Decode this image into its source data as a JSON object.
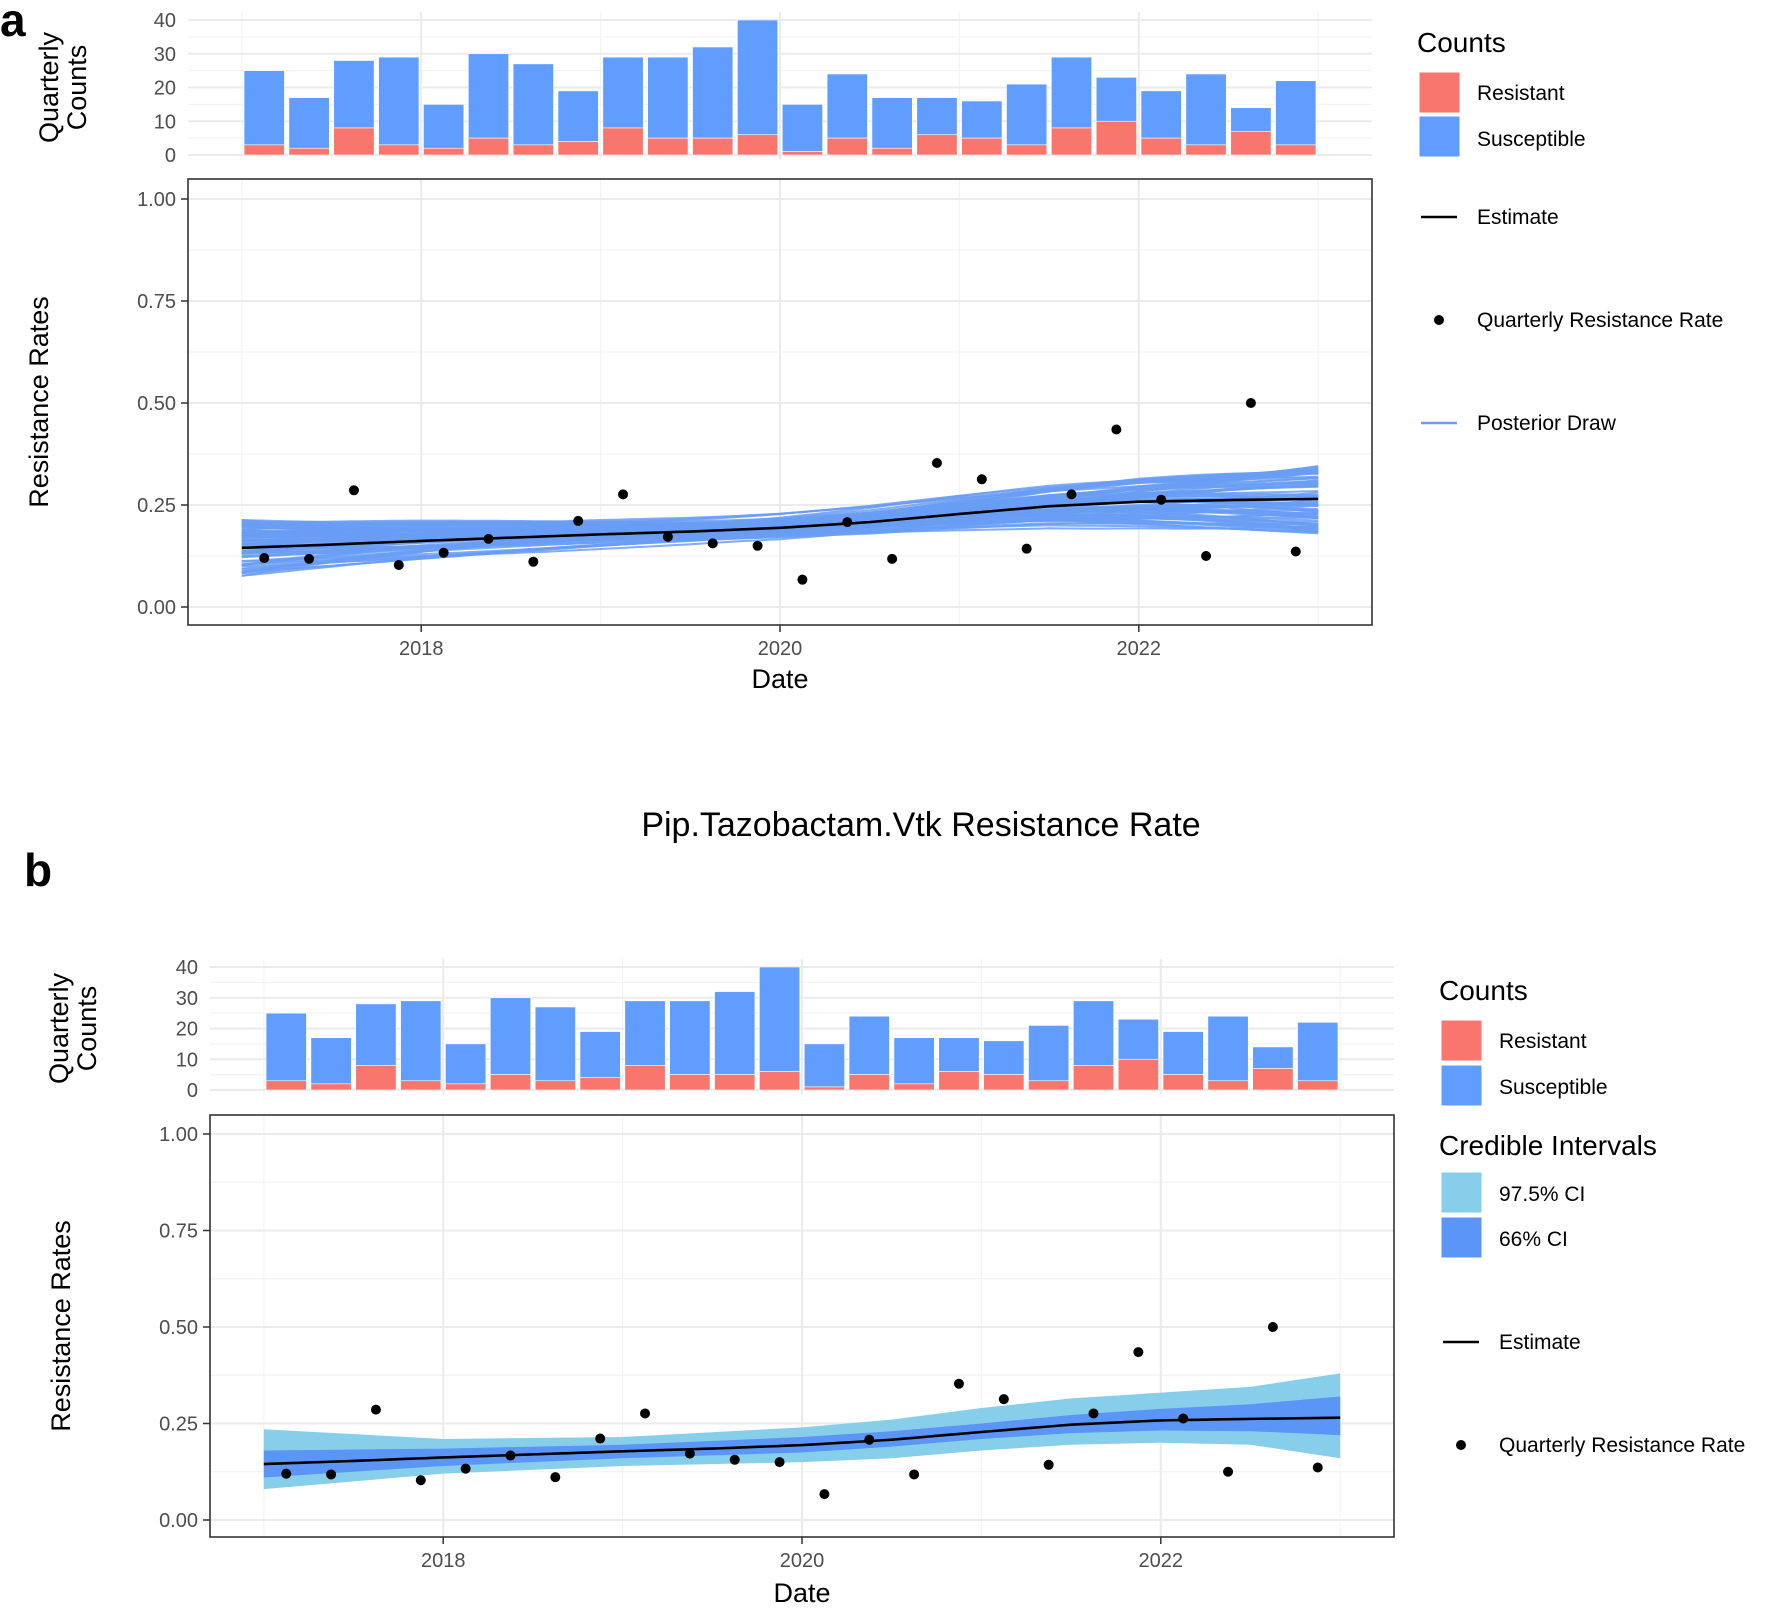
{
  "panel_labels": [
    "a",
    "b"
  ],
  "title_b": "Pip.Tazobactam.Vtk Resistance Rate",
  "colors": {
    "resistant": "#F8766D",
    "susceptible": "#619CFF",
    "ci975": "#87CEEB",
    "ci66": "#5B95F5",
    "estimate": "#000000",
    "posterior": "#6A9EF5"
  },
  "legend": {
    "counts_title": "Counts",
    "resistant": "Resistant",
    "susceptible": "Susceptible",
    "ci_title": "Credible Intervals",
    "ci975": "97.5% CI",
    "ci66": "66% CI",
    "estimate": "Estimate",
    "rate": "Quarterly Resistance Rate",
    "posterior": "Posterior Draw"
  },
  "chart_data": [
    {
      "type": "bar",
      "panel": "a-top",
      "ylabel": [
        "Quarterly",
        "Counts"
      ],
      "stacked": true,
      "x_quarter_midpoints": [
        2017.125,
        2017.375,
        2017.625,
        2017.875,
        2018.125,
        2018.375,
        2018.625,
        2018.875,
        2019.125,
        2019.375,
        2019.625,
        2019.875,
        2020.125,
        2020.375,
        2020.625,
        2020.875,
        2021.125,
        2021.375,
        2021.625,
        2021.875,
        2022.125,
        2022.375,
        2022.625,
        2022.875
      ],
      "series": [
        {
          "name": "Resistant",
          "values": [
            3,
            2,
            8,
            3,
            2,
            5,
            3,
            4,
            8,
            5,
            5,
            6,
            1,
            5,
            2,
            6,
            5,
            3,
            8,
            10,
            5,
            3,
            7,
            3
          ]
        },
        {
          "name": "Susceptible",
          "values": [
            22,
            15,
            20,
            26,
            13,
            25,
            24,
            15,
            21,
            24,
            27,
            34,
            14,
            19,
            15,
            11,
            11,
            18,
            21,
            13,
            14,
            21,
            7,
            19
          ]
        }
      ],
      "yticks": [
        0,
        10,
        20,
        30,
        40
      ],
      "ylim": [
        0,
        40
      ],
      "xlim": [
        2016.7,
        2023.3
      ]
    },
    {
      "type": "line",
      "panel": "a-bottom",
      "xlabel": "Date",
      "ylabel": "Resistance Rates",
      "xticks": [
        2018,
        2020,
        2022
      ],
      "yticks": [
        "0.00",
        "0.25",
        "0.50",
        "0.75",
        "1.00"
      ],
      "ylim": [
        0,
        1
      ],
      "xlim": [
        2016.7,
        2023.3
      ],
      "grid": true,
      "estimate": {
        "x": [
          2017,
          2017.5,
          2018,
          2018.5,
          2019,
          2019.5,
          2020,
          2020.5,
          2021,
          2021.5,
          2022,
          2022.5,
          2023
        ],
        "y": [
          0.145,
          0.153,
          0.162,
          0.17,
          0.178,
          0.185,
          0.194,
          0.208,
          0.228,
          0.247,
          0.258,
          0.262,
          0.265
        ]
      },
      "rates": [
        0.12,
        0.118,
        0.286,
        0.103,
        0.133,
        0.167,
        0.111,
        0.211,
        0.276,
        0.172,
        0.156,
        0.15,
        0.067,
        0.208,
        0.118,
        0.353,
        0.313,
        0.143,
        0.276,
        0.435,
        0.263,
        0.125,
        0.5,
        0.136
      ],
      "posterior_draws": "many draws spanning about 0.07–0.24 at 2017 and 0.10–0.41 at 2023"
    },
    {
      "type": "bar",
      "panel": "b-top",
      "ylabel": [
        "Quarterly",
        "Counts"
      ],
      "same_as": "a-top"
    },
    {
      "type": "area",
      "panel": "b-bottom",
      "xlabel": "Date",
      "ylabel": "Resistance Rates",
      "xticks": [
        2018,
        2020,
        2022
      ],
      "yticks": [
        "0.00",
        "0.25",
        "0.50",
        "0.75",
        "1.00"
      ],
      "ylim": [
        0,
        1
      ],
      "ci975": {
        "x": [
          2017,
          2018,
          2019,
          2020,
          2020.5,
          2021,
          2021.5,
          2022,
          2022.5,
          2023
        ],
        "lo": [
          0.08,
          0.12,
          0.14,
          0.15,
          0.16,
          0.18,
          0.195,
          0.2,
          0.195,
          0.16
        ],
        "hi": [
          0.235,
          0.21,
          0.215,
          0.24,
          0.26,
          0.29,
          0.315,
          0.33,
          0.345,
          0.38
        ]
      },
      "ci66": {
        "x": [
          2017,
          2018,
          2019,
          2020,
          2020.5,
          2021,
          2021.5,
          2022,
          2022.5,
          2023
        ],
        "lo": [
          0.11,
          0.14,
          0.16,
          0.175,
          0.19,
          0.21,
          0.225,
          0.232,
          0.23,
          0.22
        ],
        "hi": [
          0.18,
          0.185,
          0.195,
          0.215,
          0.23,
          0.25,
          0.272,
          0.288,
          0.3,
          0.32
        ]
      }
    }
  ]
}
